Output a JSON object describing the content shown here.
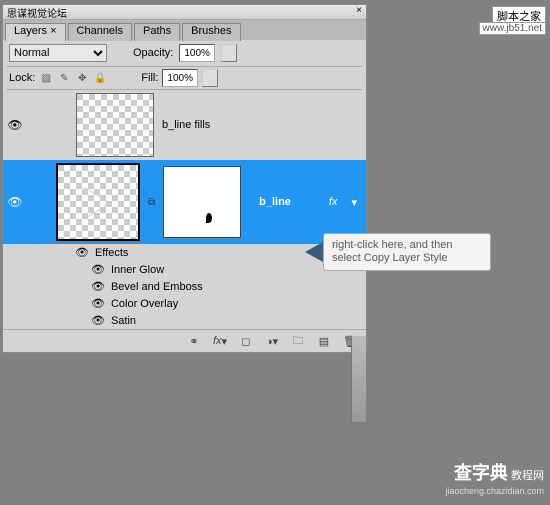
{
  "titlebar": {
    "title": "思谋视觉论坛"
  },
  "tabs": [
    "Layers",
    "Channels",
    "Paths",
    "Brushes"
  ],
  "blend": {
    "mode": "Normal",
    "opacity_label": "Opacity:",
    "opacity_value": "100%"
  },
  "lock": {
    "label": "Lock:",
    "fill_label": "Fill:",
    "fill_value": "100%"
  },
  "layers": [
    {
      "name": "b_line fills"
    },
    {
      "name": "b_line"
    }
  ],
  "effects": {
    "header": "Effects",
    "items": [
      "Inner Glow",
      "Bevel and Emboss",
      "Color Overlay",
      "Satin"
    ]
  },
  "callout": {
    "text": "right-click here, and then select Copy Layer Style"
  },
  "watermark": {
    "a": "脚本之家",
    "b": "www.jb51.net",
    "c_main": "查字典",
    "c_sub": "教程网",
    "c_url": "jiaocheng.chazidian.com"
  }
}
